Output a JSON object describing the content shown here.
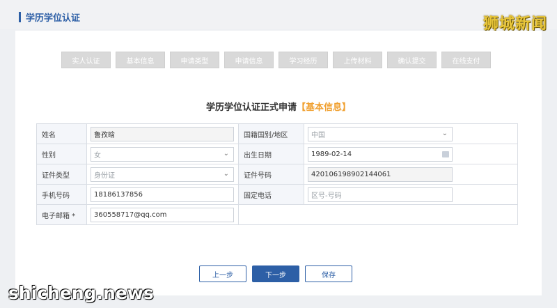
{
  "header": {
    "title": "学历学位认证"
  },
  "watermarks": {
    "top_right": "狮城新闻",
    "bottom_left": "shicheng.news"
  },
  "steps": [
    "实人认证",
    "基本信息",
    "申请类型",
    "申请信息",
    "学习经历",
    "上传材料",
    "确认提交",
    "在线支付"
  ],
  "form": {
    "title": "学历学位认证正式申请",
    "section": "【基本信息】",
    "fields": {
      "name": {
        "label": "姓名",
        "value": "鲁孜晗"
      },
      "nationality": {
        "label": "国籍国别/地区",
        "value": "中国"
      },
      "gender": {
        "label": "性别",
        "value": "女"
      },
      "birth": {
        "label": "出生日期",
        "value": "1989-02-14"
      },
      "id_type": {
        "label": "证件类型",
        "value": "身份证"
      },
      "id_number": {
        "label": "证件号码",
        "value": "420106198902144061"
      },
      "mobile": {
        "label": "手机号码",
        "value": "18186137856"
      },
      "phone": {
        "label": "固定电话",
        "placeholder": "区号-号码"
      },
      "email": {
        "label": "电子邮箱 *",
        "value": "360558717@qq.com"
      }
    }
  },
  "buttons": {
    "prev": "上一步",
    "next": "下一步",
    "save": "保存"
  },
  "colors": {
    "accent": "#2d5fa6",
    "highlight": "#f0a030"
  }
}
